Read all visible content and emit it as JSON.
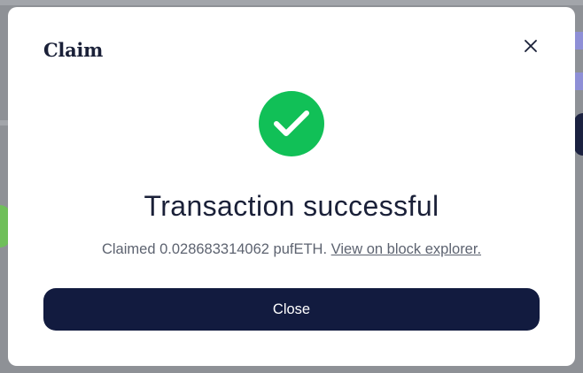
{
  "modal": {
    "title": "Claim",
    "headline": "Transaction successful",
    "message_prefix": "Claimed 0.028683314062 pufETH.",
    "explorer_link_label": "View on block explorer.",
    "close_button_label": "Close",
    "close_icon": "close-icon",
    "status_icon": "check-circle-icon"
  },
  "colors": {
    "success": "#11c057",
    "primary_button": "#121b3f",
    "title_text": "#1a2038",
    "muted_text": "#5d6370"
  }
}
